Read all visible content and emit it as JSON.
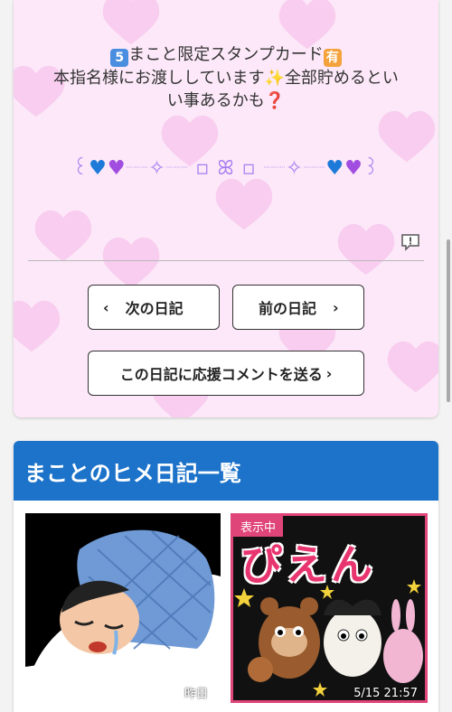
{
  "diary": {
    "message_line1": "まこと限定スタンプカード",
    "emoji_5": "5",
    "emoji_yu": "有",
    "message_line2": "本指名様にお渡ししています",
    "message_line2b": "全部貯めるとい",
    "message_line3": "い事あるかも",
    "sparkle": "✨",
    "question": "❓"
  },
  "deco": {
    "left_curl": "꒰",
    "right_curl": "꒱",
    "heart": "♥",
    "star": "✧",
    "square": "▫",
    "flower": "ꕤ",
    "dots": "┈┈┈"
  },
  "buttons": {
    "next_label": "次の日記",
    "prev_label": "前の日記",
    "comment_label": "この日記に応援コメントを送る",
    "chev_left": "‹",
    "chev_right": "›"
  },
  "list": {
    "title": "まことのヒメ日記一覧",
    "items": [
      {
        "time": "昨日"
      },
      {
        "badge": "表示中",
        "time": "5/15 21:57",
        "image_text": "ぴえん"
      }
    ]
  }
}
